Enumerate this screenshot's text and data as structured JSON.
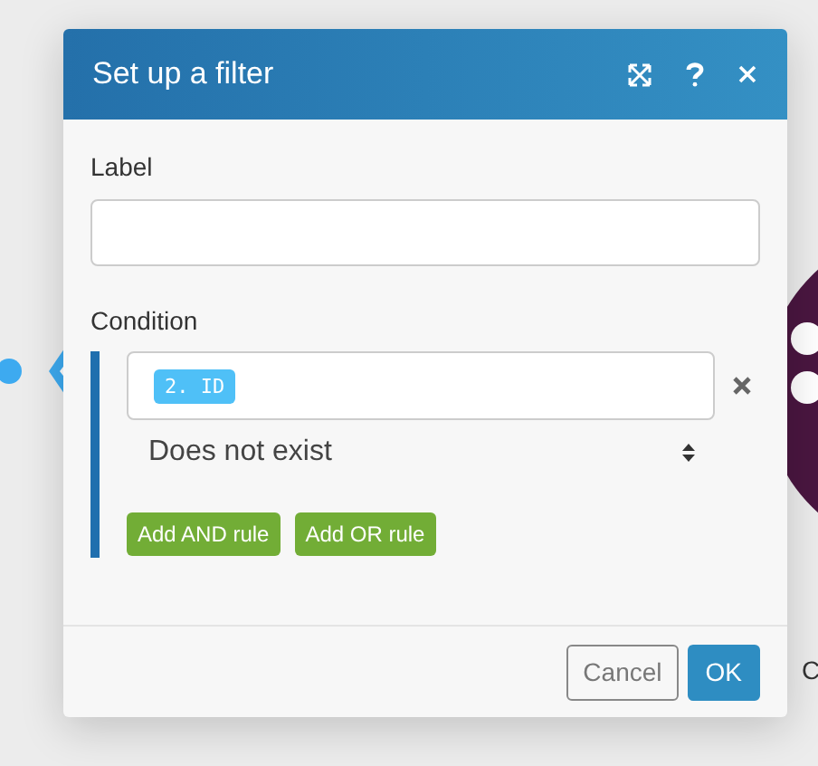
{
  "dialog": {
    "title": "Set up a filter",
    "label_field": {
      "label": "Label"
    },
    "condition": {
      "label": "Condition",
      "rules": [
        {
          "operand": "2. ID",
          "operator": "Does not exist"
        }
      ],
      "add_buttons": [
        "Add AND rule",
        "Add OR rule"
      ]
    },
    "buttons": [
      {
        "label": "Cancel",
        "kind": "secondary"
      },
      {
        "label": "OK",
        "kind": "primary"
      }
    ]
  },
  "canvas_label": "C"
}
